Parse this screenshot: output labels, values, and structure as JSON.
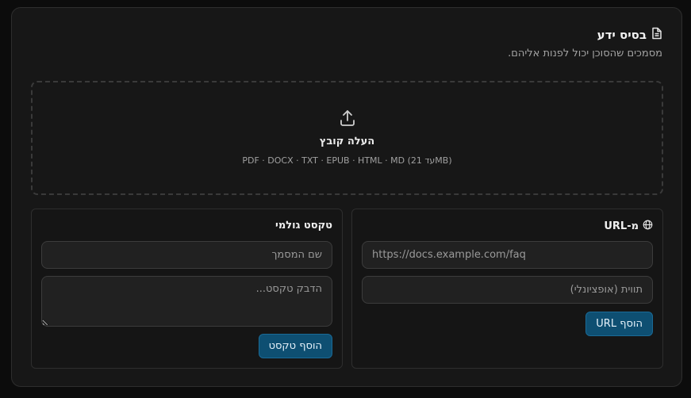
{
  "header": {
    "title": "בסיס ידע",
    "title_icon": "document-icon",
    "subtitle": "מסמכים שהסוכן יכול לפנות אליהם."
  },
  "upload": {
    "icon": "upload-icon",
    "title": "העלה קובץ",
    "hint": "PDF · DOCX · TXT · EPUB · HTML · MD (עד 21MB)"
  },
  "url_panel": {
    "title": "מ-URL",
    "icon": "globe-icon",
    "url_placeholder": "https://docs.example.com/faq",
    "label_placeholder": "תווית (אופציונלי)",
    "button": "הוסף URL"
  },
  "text_panel": {
    "title": "טקסט גולמי",
    "name_placeholder": "שם המסמך",
    "text_placeholder": "הדבק טקסט...",
    "button": "הוסף טקסט"
  },
  "colors": {
    "background": "#0c0c0c",
    "card": "#171717",
    "accent_button": "#0e4f72",
    "field": "#212121"
  }
}
